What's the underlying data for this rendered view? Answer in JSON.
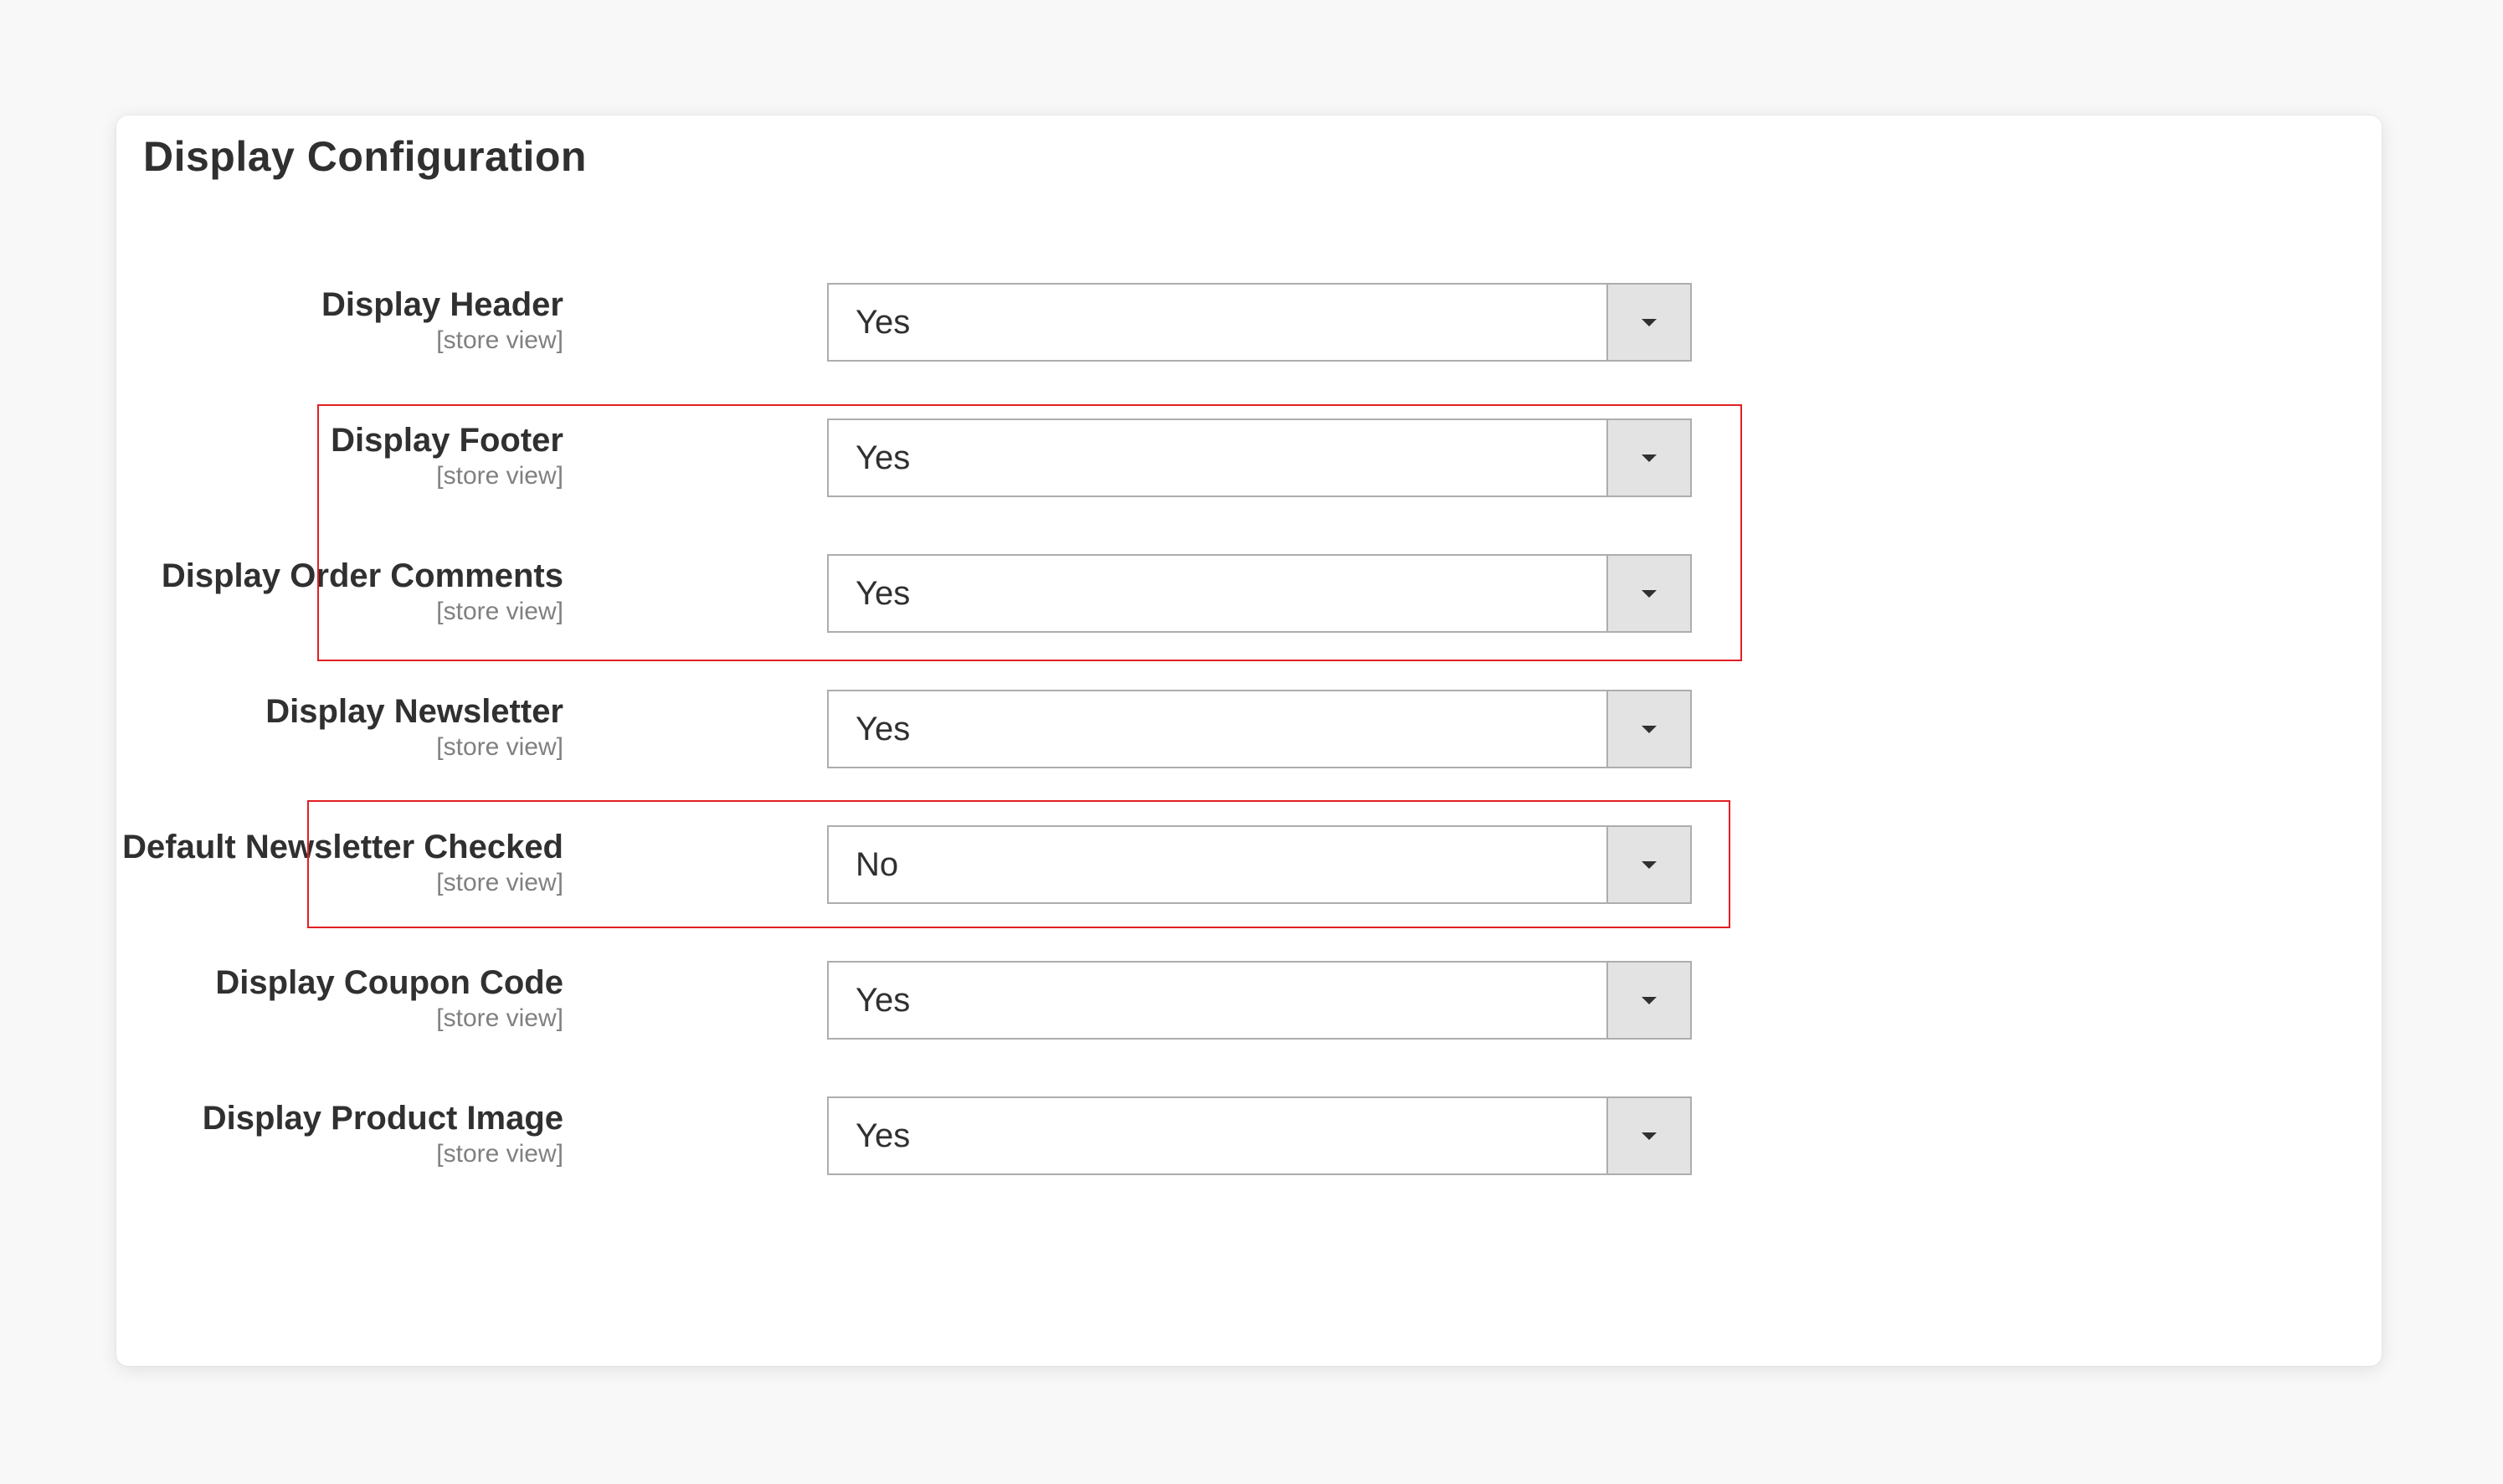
{
  "panel": {
    "title": "Display Configuration"
  },
  "fields": [
    {
      "label": "Display Header",
      "scope": "[store view]",
      "value": "Yes"
    },
    {
      "label": "Display Footer",
      "scope": "[store view]",
      "value": "Yes"
    },
    {
      "label": "Display Order Comments",
      "scope": "[store view]",
      "value": "Yes"
    },
    {
      "label": "Display Newsletter",
      "scope": "[store view]",
      "value": "Yes"
    },
    {
      "label": "Default Newsletter Checked",
      "scope": "[store view]",
      "value": "No"
    },
    {
      "label": "Display Coupon Code",
      "scope": "[store view]",
      "value": "Yes"
    },
    {
      "label": "Display Product Image",
      "scope": "[store view]",
      "value": "Yes"
    }
  ],
  "colors": {
    "highlight_border": "#e31e24",
    "page_background": "#f8f8f8",
    "text": "#303030",
    "scope_text": "#808080"
  }
}
